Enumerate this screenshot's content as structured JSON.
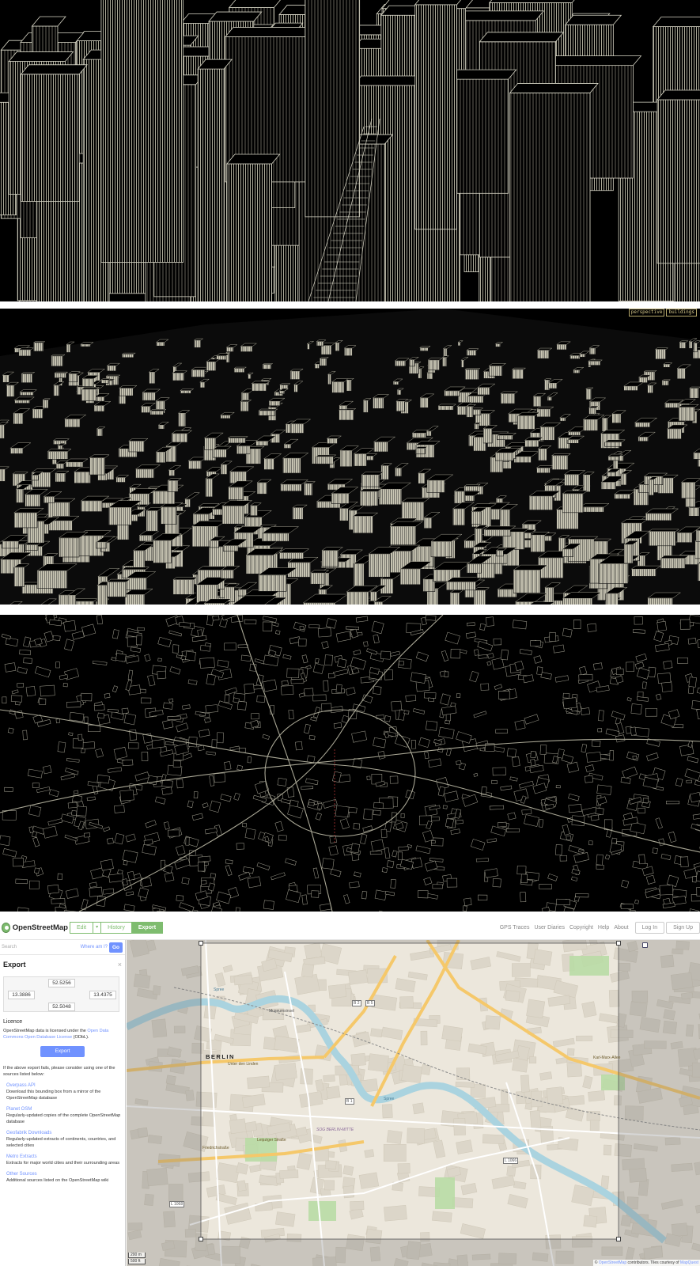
{
  "renders": {
    "badges": [
      "perspective",
      "buildings"
    ]
  },
  "osm": {
    "brand": "OpenStreetMap",
    "logo_icon": "openstreetmap-logo-icon",
    "toolbar": {
      "edit": "Edit",
      "edit_caret": "▾",
      "history": "History",
      "export": "Export"
    },
    "nav": {
      "gps_traces": "GPS Traces",
      "user_diaries": "User Diaries",
      "copyright": "Copyright",
      "help": "Help",
      "about": "About",
      "log_in": "Log In",
      "sign_up": "Sign Up"
    },
    "search": {
      "placeholder": "Search",
      "where_am_i": "Where am I?",
      "go": "Go"
    },
    "export_panel": {
      "title": "Export",
      "close": "×",
      "bbox": {
        "north": "52.5256",
        "west": "13.3886",
        "east": "13.4375",
        "south": "52.5048"
      },
      "licence_title": "Licence",
      "licence_text_pre": "OpenStreetMap data is licensed under the ",
      "licence_link": "Open Data Commons Open Database License",
      "licence_text_post": " (ODbL).",
      "export_button": "Export",
      "fallback_text": "If the above export fails, please consider using one of the sources listed below:",
      "sources": [
        {
          "name": "Overpass API",
          "desc": "Download this bounding box from a mirror of the OpenStreetMap database"
        },
        {
          "name": "Planet OSM",
          "desc": "Regularly-updated copies of the complete OpenStreetMap database"
        },
        {
          "name": "Geofabrik Downloads",
          "desc": "Regularly-updated extracts of continents, countries, and selected cities"
        },
        {
          "name": "Metro Extracts",
          "desc": "Extracts for major world cities and their surrounding areas"
        },
        {
          "name": "Other Sources",
          "desc": "Additional sources listed on the OpenStreetMap wiki"
        }
      ]
    },
    "map": {
      "city_label": "BERLIN",
      "labels": {
        "unter_den_linden": "Unter den Linden",
        "karl_marx_allee": "Karl-Marx-Allee",
        "leipziger_strasse": "Leipziger Straße",
        "spree": "Spree",
        "mitte": "SOG BERLIN-MITTE",
        "museumsinsel": "Museumsinsel",
        "friedrichstrasse": "Friedrichstraße",
        "b2": "B 2",
        "b5": "B 5",
        "b1": "B 1",
        "l1066": "L 1066",
        "l1068": "L 1068"
      },
      "scale_m": "200 m",
      "scale_ft": "500 ft",
      "attribution_pre": "© ",
      "attribution_link": "OpenStreetMap",
      "attribution_post": " contributors. Tiles courtesy of ",
      "attribution_link2": "MapQuest"
    }
  }
}
